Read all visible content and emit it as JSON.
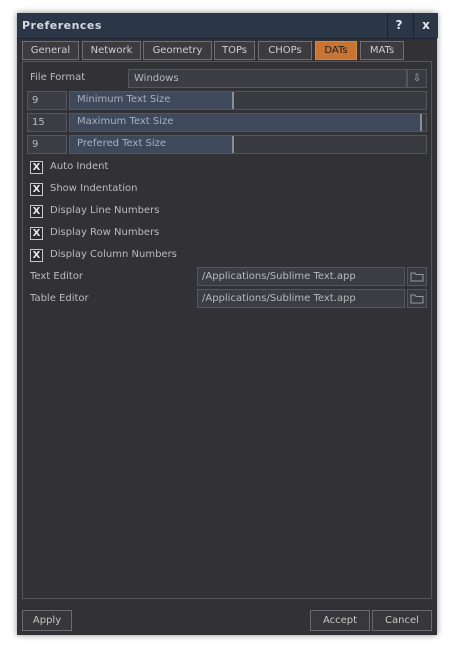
{
  "window": {
    "title": "Preferences",
    "help_label": "?",
    "close_label": "x"
  },
  "tabs": [
    {
      "label": "General"
    },
    {
      "label": "Network"
    },
    {
      "label": "Geometry"
    },
    {
      "label": "TOPs"
    },
    {
      "label": "CHOPs"
    },
    {
      "label": "DATs",
      "active": true
    },
    {
      "label": "MATs"
    }
  ],
  "dats": {
    "file_format": {
      "label": "File Format",
      "value": "Windows"
    },
    "min_text_size": {
      "value": "9",
      "label": "Minimum Text Size",
      "fraction": 0.46
    },
    "max_text_size": {
      "value": "15",
      "label": "Maximum Text Size",
      "fraction": 0.99
    },
    "pref_text_size": {
      "value": "9",
      "label": "Prefered Text Size",
      "fraction": 0.46
    },
    "checkboxes": [
      {
        "label": "Auto Indent",
        "checked": true
      },
      {
        "label": "Show Indentation",
        "checked": true
      },
      {
        "label": "Display Line Numbers",
        "checked": true
      },
      {
        "label": "Display Row Numbers",
        "checked": true
      },
      {
        "label": "Display Column Numbers",
        "checked": true
      }
    ],
    "check_mark": "X",
    "text_editor": {
      "label": "Text Editor",
      "value": "/Applications/Sublime Text.app"
    },
    "table_editor": {
      "label": "Table Editor",
      "value": "/Applications/Sublime Text.app"
    },
    "dropdown_arrow": "⇩"
  },
  "footer": {
    "apply_label": "Apply",
    "accept_label": "Accept",
    "cancel_label": "Cancel"
  },
  "icons": {
    "dropdown": "dropdown-arrow-icon",
    "folder": "folder-icon"
  },
  "colors": {
    "active_tab": "#c87534",
    "titlebar": "#2b3646",
    "background": "#313136"
  }
}
